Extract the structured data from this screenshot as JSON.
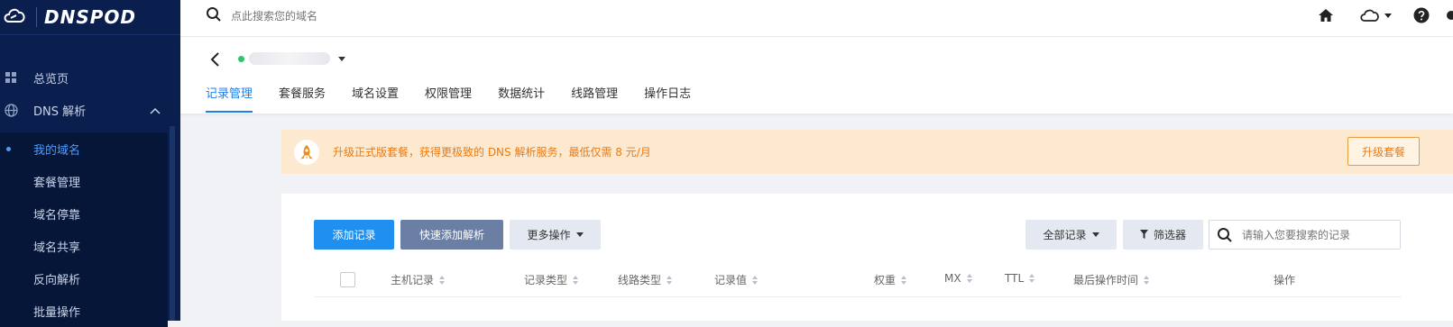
{
  "sidebar": {
    "brand": "DNSPOD",
    "overview": "总览页",
    "dns_section": "DNS 解析",
    "sub_items": [
      "我的域名",
      "套餐管理",
      "域名停靠",
      "域名共享",
      "反向解析",
      "批量操作"
    ]
  },
  "topbar": {
    "search_placeholder": "点此搜索您的域名"
  },
  "domain": {
    "name": ""
  },
  "tabs": [
    "记录管理",
    "套餐服务",
    "域名设置",
    "权限管理",
    "数据统计",
    "线路管理",
    "操作日志"
  ],
  "notice": {
    "text": "升级正式版套餐，获得更极致的 DNS 解析服务，最低仅需 8 元/月",
    "button": "升级套餐"
  },
  "toolbar": {
    "add_record": "添加记录",
    "quick_add": "快速添加解析",
    "more_actions": "更多操作",
    "all_records": "全部记录",
    "filter": "筛选器",
    "search_placeholder": "请输入您要搜索的记录"
  },
  "table": {
    "columns": [
      "主机记录",
      "记录类型",
      "线路类型",
      "记录值",
      "权重",
      "MX",
      "TTL",
      "最后操作时间",
      "操作"
    ]
  },
  "colors": {
    "sidebar_bg": "#0a1f4d",
    "accent": "#1e7fe8",
    "notice_bg": "#fde9d0",
    "notice_text": "#ec7a12",
    "domain_status": "#2ec56b"
  }
}
